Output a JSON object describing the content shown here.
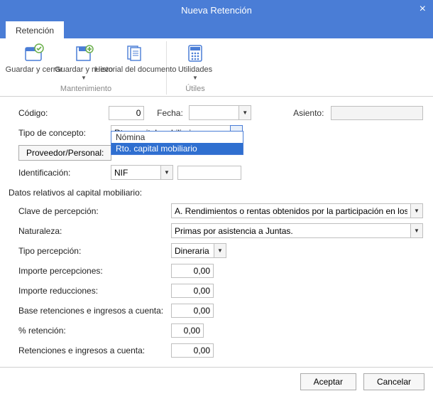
{
  "window": {
    "title": "Nueva Retención"
  },
  "tabs": {
    "retencion": "Retención"
  },
  "ribbon": {
    "guardar_cerrar": "Guardar y cerrar",
    "guardar_nuevo": "Guardar y nuevo",
    "historial": "Historial del documento",
    "utilidades": "Utilidades",
    "group_mantenimiento": "Mantenimiento",
    "group_utiles": "Útiles"
  },
  "form": {
    "codigo_label": "Código:",
    "codigo_value": "0",
    "fecha_label": "Fecha:",
    "fecha_value": "",
    "asiento_label": "Asiento:",
    "asiento_value": "",
    "tipo_concepto_label": "Tipo de concepto:",
    "tipo_concepto_value": "Rto. capital mobiliario",
    "tipo_concepto_options": {
      "nomina": "Nómina",
      "rto": "Rto. capital mobiliario"
    },
    "proveedor_btn": "Proveedor/Personal:",
    "proveedor_value": "",
    "identificacion_label": "Identificación:",
    "identificacion_type": "NIF",
    "identificacion_value": ""
  },
  "section": {
    "title": "Datos relativos al capital mobiliario:",
    "clave_label": "Clave de percepción:",
    "clave_value": "A. Rendimientos o rentas obtenidos por la participación en los fo",
    "naturaleza_label": "Naturaleza:",
    "naturaleza_value": "Primas por asistencia a Juntas.",
    "tipo_percepcion_label": "Tipo percepción:",
    "tipo_percepcion_value": "Dineraria",
    "importe_percepciones_label": "Importe percepciones:",
    "importe_percepciones_value": "0,00",
    "importe_reducciones_label": "Importe reducciones:",
    "importe_reducciones_value": "0,00",
    "base_label": "Base retenciones e ingresos a cuenta:",
    "base_value": "0,00",
    "pct_label": "% retención:",
    "pct_value": "0,00",
    "ret_label": "Retenciones e ingresos a cuenta:",
    "ret_value": "0,00"
  },
  "footer": {
    "aceptar": "Aceptar",
    "cancelar": "Cancelar"
  }
}
